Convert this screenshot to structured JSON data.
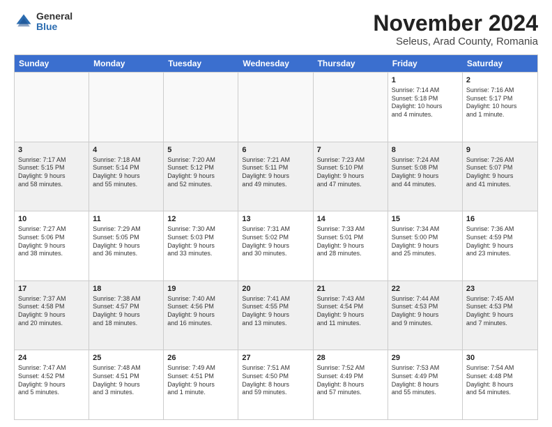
{
  "logo": {
    "general": "General",
    "blue": "Blue"
  },
  "title": "November 2024",
  "location": "Seleus, Arad County, Romania",
  "header_days": [
    "Sunday",
    "Monday",
    "Tuesday",
    "Wednesday",
    "Thursday",
    "Friday",
    "Saturday"
  ],
  "weeks": [
    [
      {
        "day": "",
        "info": ""
      },
      {
        "day": "",
        "info": ""
      },
      {
        "day": "",
        "info": ""
      },
      {
        "day": "",
        "info": ""
      },
      {
        "day": "",
        "info": ""
      },
      {
        "day": "1",
        "info": "Sunrise: 7:14 AM\nSunset: 5:18 PM\nDaylight: 10 hours\nand 4 minutes."
      },
      {
        "day": "2",
        "info": "Sunrise: 7:16 AM\nSunset: 5:17 PM\nDaylight: 10 hours\nand 1 minute."
      }
    ],
    [
      {
        "day": "3",
        "info": "Sunrise: 7:17 AM\nSunset: 5:15 PM\nDaylight: 9 hours\nand 58 minutes."
      },
      {
        "day": "4",
        "info": "Sunrise: 7:18 AM\nSunset: 5:14 PM\nDaylight: 9 hours\nand 55 minutes."
      },
      {
        "day": "5",
        "info": "Sunrise: 7:20 AM\nSunset: 5:12 PM\nDaylight: 9 hours\nand 52 minutes."
      },
      {
        "day": "6",
        "info": "Sunrise: 7:21 AM\nSunset: 5:11 PM\nDaylight: 9 hours\nand 49 minutes."
      },
      {
        "day": "7",
        "info": "Sunrise: 7:23 AM\nSunset: 5:10 PM\nDaylight: 9 hours\nand 47 minutes."
      },
      {
        "day": "8",
        "info": "Sunrise: 7:24 AM\nSunset: 5:08 PM\nDaylight: 9 hours\nand 44 minutes."
      },
      {
        "day": "9",
        "info": "Sunrise: 7:26 AM\nSunset: 5:07 PM\nDaylight: 9 hours\nand 41 minutes."
      }
    ],
    [
      {
        "day": "10",
        "info": "Sunrise: 7:27 AM\nSunset: 5:06 PM\nDaylight: 9 hours\nand 38 minutes."
      },
      {
        "day": "11",
        "info": "Sunrise: 7:29 AM\nSunset: 5:05 PM\nDaylight: 9 hours\nand 36 minutes."
      },
      {
        "day": "12",
        "info": "Sunrise: 7:30 AM\nSunset: 5:03 PM\nDaylight: 9 hours\nand 33 minutes."
      },
      {
        "day": "13",
        "info": "Sunrise: 7:31 AM\nSunset: 5:02 PM\nDaylight: 9 hours\nand 30 minutes."
      },
      {
        "day": "14",
        "info": "Sunrise: 7:33 AM\nSunset: 5:01 PM\nDaylight: 9 hours\nand 28 minutes."
      },
      {
        "day": "15",
        "info": "Sunrise: 7:34 AM\nSunset: 5:00 PM\nDaylight: 9 hours\nand 25 minutes."
      },
      {
        "day": "16",
        "info": "Sunrise: 7:36 AM\nSunset: 4:59 PM\nDaylight: 9 hours\nand 23 minutes."
      }
    ],
    [
      {
        "day": "17",
        "info": "Sunrise: 7:37 AM\nSunset: 4:58 PM\nDaylight: 9 hours\nand 20 minutes."
      },
      {
        "day": "18",
        "info": "Sunrise: 7:38 AM\nSunset: 4:57 PM\nDaylight: 9 hours\nand 18 minutes."
      },
      {
        "day": "19",
        "info": "Sunrise: 7:40 AM\nSunset: 4:56 PM\nDaylight: 9 hours\nand 16 minutes."
      },
      {
        "day": "20",
        "info": "Sunrise: 7:41 AM\nSunset: 4:55 PM\nDaylight: 9 hours\nand 13 minutes."
      },
      {
        "day": "21",
        "info": "Sunrise: 7:43 AM\nSunset: 4:54 PM\nDaylight: 9 hours\nand 11 minutes."
      },
      {
        "day": "22",
        "info": "Sunrise: 7:44 AM\nSunset: 4:53 PM\nDaylight: 9 hours\nand 9 minutes."
      },
      {
        "day": "23",
        "info": "Sunrise: 7:45 AM\nSunset: 4:53 PM\nDaylight: 9 hours\nand 7 minutes."
      }
    ],
    [
      {
        "day": "24",
        "info": "Sunrise: 7:47 AM\nSunset: 4:52 PM\nDaylight: 9 hours\nand 5 minutes."
      },
      {
        "day": "25",
        "info": "Sunrise: 7:48 AM\nSunset: 4:51 PM\nDaylight: 9 hours\nand 3 minutes."
      },
      {
        "day": "26",
        "info": "Sunrise: 7:49 AM\nSunset: 4:51 PM\nDaylight: 9 hours\nand 1 minute."
      },
      {
        "day": "27",
        "info": "Sunrise: 7:51 AM\nSunset: 4:50 PM\nDaylight: 8 hours\nand 59 minutes."
      },
      {
        "day": "28",
        "info": "Sunrise: 7:52 AM\nSunset: 4:49 PM\nDaylight: 8 hours\nand 57 minutes."
      },
      {
        "day": "29",
        "info": "Sunrise: 7:53 AM\nSunset: 4:49 PM\nDaylight: 8 hours\nand 55 minutes."
      },
      {
        "day": "30",
        "info": "Sunrise: 7:54 AM\nSunset: 4:48 PM\nDaylight: 8 hours\nand 54 minutes."
      }
    ]
  ]
}
